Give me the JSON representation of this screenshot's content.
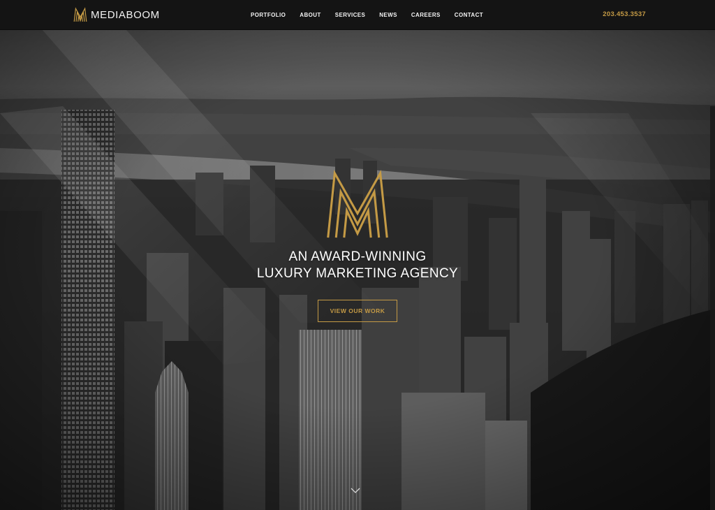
{
  "header": {
    "brand": {
      "name": "MEDIABOOM",
      "logo_icon": "mediaboom-m-logo-icon"
    },
    "nav": [
      {
        "label": "PORTFOLIO"
      },
      {
        "label": "ABOUT"
      },
      {
        "label": "SERVICES"
      },
      {
        "label": "NEWS"
      },
      {
        "label": "CAREERS"
      },
      {
        "label": "CONTACT"
      }
    ],
    "phone": "203.453.3537"
  },
  "hero": {
    "logo_icon": "mediaboom-m-logo-icon",
    "title_line1": "AN AWARD-WINNING",
    "title_line2": "LUXURY MARKETING AGENCY",
    "cta_label": "VIEW OUR WORK",
    "scroll_icon": "chevron-down-icon",
    "background": "black-and-white aerial city skyline photo"
  },
  "colors": {
    "accent_gold": "#c49a45",
    "header_bg": "#141414",
    "text_white": "#ffffff"
  }
}
